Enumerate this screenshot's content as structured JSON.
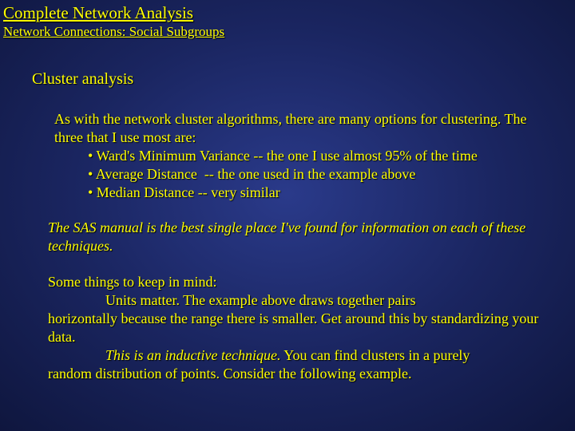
{
  "title": "Complete Network Analysis",
  "subtitle": "Network Connections: Social Subgroups",
  "section_heading": "Cluster analysis",
  "intro": "As with the network cluster algorithms, there are many options for clustering.  The three that I use most are:",
  "bullets": {
    "b1": "• Ward's Minimum Variance -- the one I use almost 95% of the time",
    "b2": "• Average Distance  -- the one used in the example above",
    "b3": "• Median Distance -- very similar"
  },
  "note": "The SAS manual is the best single place I've found for information on each of these techniques.",
  "keep_intro": "Some things to keep in mind:",
  "units_line1": "Units matter.  The example above draws together pairs",
  "units_line2": "horizontally because the range there is smaller. Get around this by standardizing your data.",
  "inductive_label": "This is an inductive technique.",
  "inductive_rest": "  You can find clusters in a purely",
  "inductive_line2": "random distribution of points.  Consider the following example."
}
